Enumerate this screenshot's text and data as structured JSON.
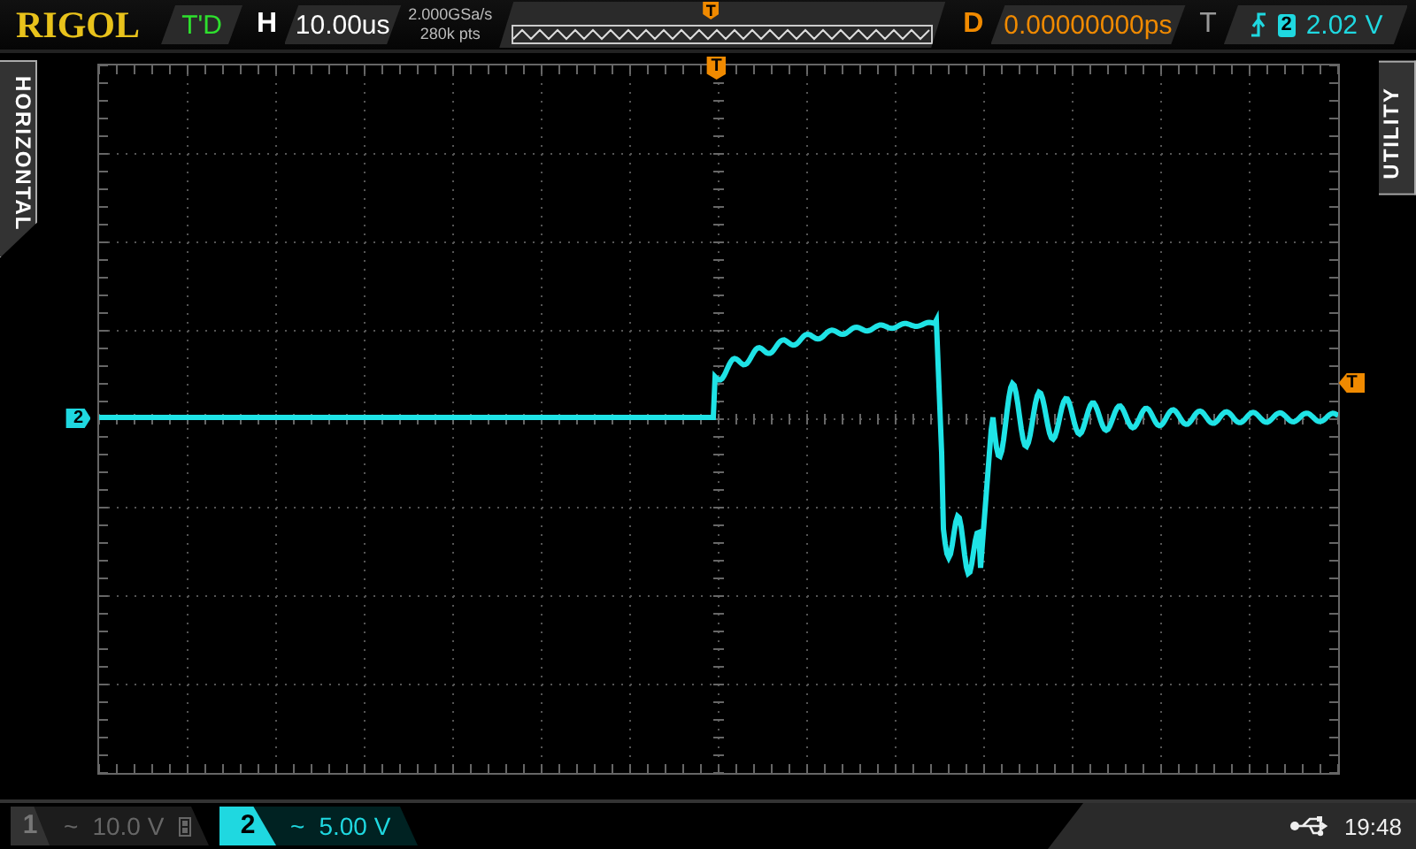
{
  "brand": "RIGOL",
  "status": "T'D",
  "timebase": {
    "label": "H",
    "value": "10.00us"
  },
  "acquisition": {
    "sample_rate": "2.000GSa/s",
    "memory_depth": "280k pts"
  },
  "memory_bar": {
    "trigger_marker": "T"
  },
  "delay": {
    "label": "D",
    "value": "0.00000000ps"
  },
  "trigger": {
    "label": "T",
    "channel": "2",
    "level": "2.02 V"
  },
  "side_tabs": {
    "left": "HORIZONTAL",
    "right": "UTILITY"
  },
  "screen": {
    "trigger_position_marker": "T",
    "channel_marker": "2",
    "trigger_level_marker": "T"
  },
  "channels": [
    {
      "number": "1",
      "coupling": "~",
      "scale": "10.0 V",
      "selected": false
    },
    {
      "number": "2",
      "coupling": "~",
      "scale": "5.00 V",
      "selected": true
    }
  ],
  "status_bar": {
    "time": "19:48"
  }
}
